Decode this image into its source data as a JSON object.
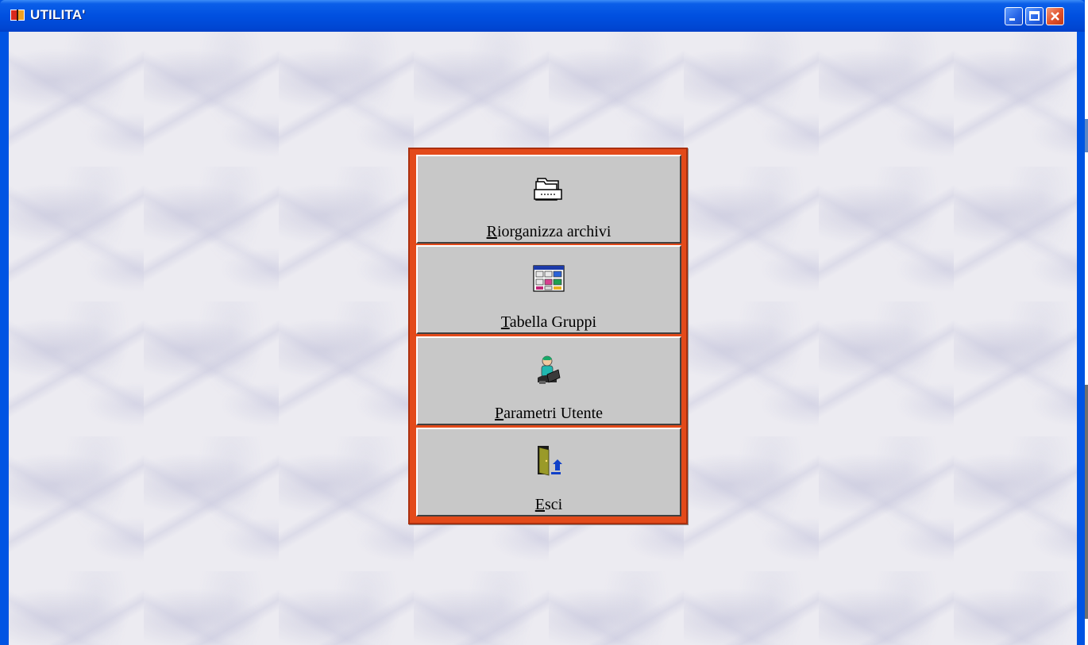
{
  "window": {
    "title": "UTILITA'",
    "app_icon": "book-icon",
    "controls": {
      "minimize_icon": "minimize-icon",
      "maximize_icon": "maximize-icon",
      "close_icon": "close-icon"
    }
  },
  "menu": {
    "items": [
      {
        "accel": "R",
        "rest": "iorganizza archivi",
        "icon": "folder-drawer-icon"
      },
      {
        "accel": "T",
        "rest": "abella Gruppi",
        "icon": "table-grid-icon"
      },
      {
        "accel": "P",
        "rest": "arametri Utente",
        "icon": "user-reading-icon"
      },
      {
        "accel": "E",
        "rest": "sci",
        "icon": "exit-door-icon"
      }
    ]
  },
  "colors": {
    "titlebar": "#0054e3",
    "panel_border": "#e34a1a",
    "button_face": "#c8c8c8",
    "close_button": "#e0502a"
  }
}
